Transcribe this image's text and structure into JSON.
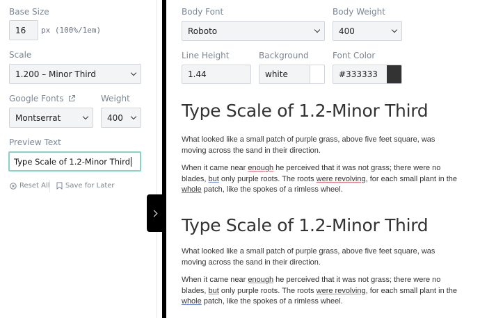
{
  "sidebar": {
    "base_size": {
      "label": "Base Size",
      "value": "16",
      "hint": "px (100%/1em)"
    },
    "scale": {
      "label": "Scale",
      "value": "1.200 – Minor Third"
    },
    "google_fonts": {
      "label": "Google Fonts",
      "value": "Montserrat"
    },
    "weight": {
      "label": "Weight",
      "value": "400"
    },
    "preview_text": {
      "label": "Preview Text",
      "value": "Type Scale of 1.2-Minor Third"
    },
    "actions": {
      "reset": "Reset All",
      "save": "Save for Later"
    }
  },
  "controls": {
    "body_font": {
      "label": "Body Font",
      "value": "Roboto"
    },
    "body_weight": {
      "label": "Body Weight",
      "value": "400"
    },
    "line_height": {
      "label": "Line Height",
      "value": "1.44"
    },
    "background": {
      "label": "Background",
      "value": "white",
      "swatch": "#ffffff"
    },
    "font_color": {
      "label": "Font Color",
      "value": "#333333",
      "swatch": "#333333"
    }
  },
  "preview": {
    "blocks": [
      {
        "heading": "Type Scale of 1.2-Minor Third",
        "para1": "What looked like a small patch of purple grass, above five feet square, was moving across the sand in their direction.",
        "para2": {
          "t1": "When it came near ",
          "w1": "enough",
          "t2": " he perceived that it was not grass; there were no blades, ",
          "w2": "but",
          "t3": " only purple roots. The roots ",
          "w3": "were revolving",
          "t4": ", for each small plant in the ",
          "w4": "whole",
          "t5": " patch, like the spokes of a rimless wheel."
        }
      },
      {
        "heading": "Type Scale of 1.2-Minor Third",
        "para1": "What looked like a small patch of purple grass, above five feet square, was moving across the sand in their direction.",
        "para2": {
          "t1": "When it came near ",
          "w1": "enough",
          "t2": " he perceived that it was not grass; there were no blades, ",
          "w2": "but",
          "t3": " only purple roots. The roots ",
          "w3": "were revolving",
          "t4": ", for each small plant in the ",
          "w4": "whole",
          "t5": " patch, like the spokes of a rimless wheel."
        }
      }
    ]
  },
  "icons": {
    "external_link": "external-link-icon",
    "reset": "x-circle-icon",
    "save": "bookmark-icon",
    "toggle": "chevron-right-icon"
  },
  "colors": {
    "accent_focus": "#86d4c6",
    "spelling_underline": "#e36d7a",
    "grammar_underline": "#6f8fe0",
    "divider": "#000000"
  }
}
